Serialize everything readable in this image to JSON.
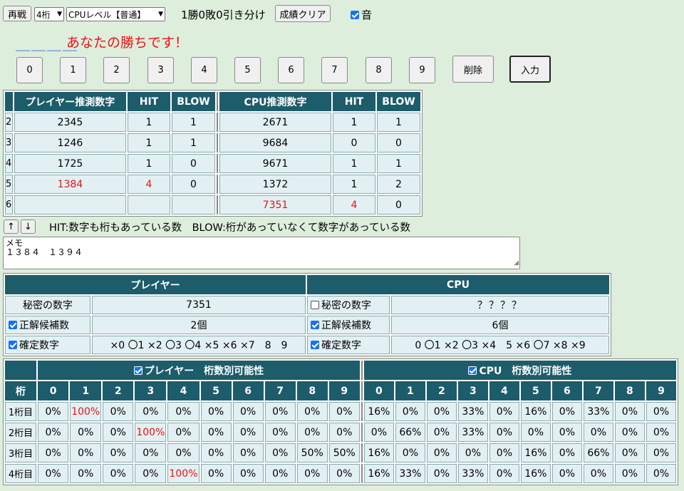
{
  "toolbar": {
    "replay_label": "再戦",
    "digits_select": "4桁",
    "cpu_level_select": "CPUレベル【普通】",
    "record_text": "1勝0敗0引き分け",
    "clear_label": "成績クリア",
    "sound_label": "音"
  },
  "input_display": "＿＿＿＿",
  "result_message": "あなたの勝ちです！",
  "keypad": {
    "digits": [
      "0",
      "1",
      "2",
      "3",
      "4",
      "5",
      "6",
      "7",
      "8",
      "9"
    ],
    "delete_label": "削除",
    "enter_label": "入力"
  },
  "history": {
    "headers": {
      "player_guess": "プレイヤー推測数字",
      "hit": "HIT",
      "blow": "BLOW",
      "cpu_guess": "CPU推測数字"
    },
    "rows": [
      {
        "no": "2",
        "p_guess": "2345",
        "p_hit": "1",
        "p_blow": "1",
        "c_guess": "2671",
        "c_hit": "1",
        "c_blow": "1"
      },
      {
        "no": "3",
        "p_guess": "1246",
        "p_hit": "1",
        "p_blow": "1",
        "c_guess": "9684",
        "c_hit": "0",
        "c_blow": "0"
      },
      {
        "no": "4",
        "p_guess": "1725",
        "p_hit": "1",
        "p_blow": "0",
        "c_guess": "9671",
        "c_hit": "1",
        "c_blow": "1"
      },
      {
        "no": "5",
        "p_guess": "1384",
        "p_hit": "4",
        "p_blow": "0",
        "c_guess": "1372",
        "c_hit": "1",
        "c_blow": "2"
      },
      {
        "no": "6",
        "p_guess": "",
        "p_hit": "",
        "p_blow": "",
        "c_guess": "7351",
        "c_hit": "4",
        "c_blow": "0"
      }
    ]
  },
  "scroll": {
    "up_label": "↑",
    "down_label": "↓"
  },
  "legend_text": "HIT:数字も桁もあっている数　BLOW:桁があっていなくて数字があっている数",
  "memo": {
    "line1": "メモ",
    "line2": "１３８４　１３９４"
  },
  "info": {
    "player_header": "プレイヤー",
    "cpu_header": "CPU",
    "secret_label": "秘密の数字",
    "player_secret": "7351",
    "cpu_secret": "？？？？",
    "candidates_label": "正解候補数",
    "player_candidates": "2個",
    "cpu_candidates": "6個",
    "confirmed_label": "確定数字",
    "player_confirmed": "×0 〇1 ×2 〇3 〇4 ×5 ×6 ×7　8　9",
    "cpu_confirmed": "0 〇1 ×2 〇3 ×4　5 ×6 〇7 ×8 ×9"
  },
  "possibility": {
    "player_title": "プレイヤー　桁数別可能性",
    "cpu_title": "CPU　桁数別可能性",
    "col_header": "桁",
    "digits": [
      "0",
      "1",
      "2",
      "3",
      "4",
      "5",
      "6",
      "7",
      "8",
      "9"
    ],
    "rows": [
      {
        "label": "1桁目",
        "player": [
          "0%",
          "100%",
          "0%",
          "0%",
          "0%",
          "0%",
          "0%",
          "0%",
          "0%",
          "0%"
        ],
        "cpu": [
          "16%",
          "0%",
          "0%",
          "33%",
          "0%",
          "16%",
          "0%",
          "33%",
          "0%",
          "0%"
        ]
      },
      {
        "label": "2桁目",
        "player": [
          "0%",
          "0%",
          "0%",
          "100%",
          "0%",
          "0%",
          "0%",
          "0%",
          "0%",
          "0%"
        ],
        "cpu": [
          "0%",
          "66%",
          "0%",
          "33%",
          "0%",
          "0%",
          "0%",
          "0%",
          "0%",
          "0%"
        ]
      },
      {
        "label": "3桁目",
        "player": [
          "0%",
          "0%",
          "0%",
          "0%",
          "0%",
          "0%",
          "0%",
          "0%",
          "50%",
          "50%"
        ],
        "cpu": [
          "16%",
          "0%",
          "0%",
          "0%",
          "0%",
          "16%",
          "0%",
          "66%",
          "0%",
          "0%"
        ]
      },
      {
        "label": "4桁目",
        "player": [
          "0%",
          "0%",
          "0%",
          "0%",
          "100%",
          "0%",
          "0%",
          "0%",
          "0%",
          "0%"
        ],
        "cpu": [
          "16%",
          "33%",
          "0%",
          "33%",
          "0%",
          "16%",
          "0%",
          "0%",
          "0%",
          "0%"
        ]
      }
    ]
  }
}
